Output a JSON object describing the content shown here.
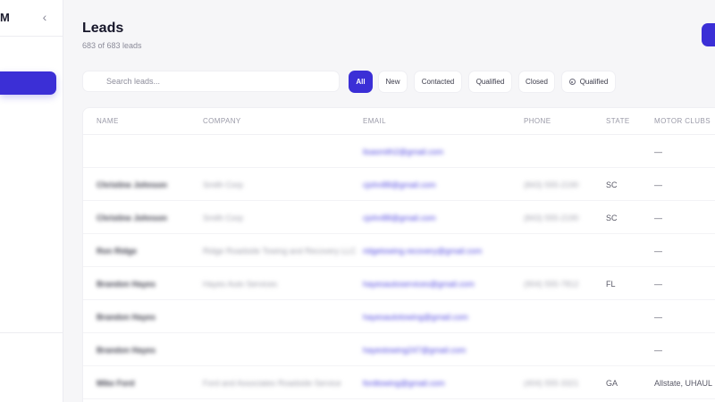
{
  "sidebar": {
    "brand": "M",
    "collapse_icon": "chevron-left-icon"
  },
  "header": {
    "title": "Leads",
    "subtitle": "683 of 683 leads"
  },
  "search": {
    "placeholder": "Search leads...",
    "icon": "search-icon"
  },
  "filters": [
    {
      "label": "All",
      "active": true
    },
    {
      "label": "New"
    },
    {
      "label": "Contacted"
    },
    {
      "label": "Qualified"
    },
    {
      "label": "Closed"
    },
    {
      "label": "Qualified",
      "icon": "target-icon"
    }
  ],
  "table": {
    "columns": [
      "NAME",
      "COMPANY",
      "EMAIL",
      "PHONE",
      "STATE",
      "MOTOR CLUBS"
    ],
    "rows": [
      {
        "name": "",
        "company": "",
        "email": "lisasmith2@gmail.com",
        "phone": "",
        "state": "",
        "clubs": "—"
      },
      {
        "name": "Christine Johnson",
        "company": "Smith Corp",
        "email": "cjohn88@gmail.com",
        "phone": "(843) 555-2190",
        "state": "SC",
        "clubs": "—"
      },
      {
        "name": "Christine Johnson",
        "company": "Smith Corp",
        "email": "cjohn88@gmail.com",
        "phone": "(843) 555-2190",
        "state": "SC",
        "clubs": "—"
      },
      {
        "name": "Ron Ridge",
        "company": "Ridge Roadside Towing and Recovery LLC",
        "email": "ridgetowing.recovery@gmail.com",
        "phone": "",
        "state": "",
        "clubs": "—"
      },
      {
        "name": "Brandon Hayes",
        "company": "Hayes Auto Services",
        "email": "hayesautoservices@gmail.com",
        "phone": "(904) 555-7812",
        "state": "FL",
        "clubs": "—"
      },
      {
        "name": "Brandon Hayes",
        "company": "",
        "email": "hayesautotowing@gmail.com",
        "phone": "",
        "state": "",
        "clubs": "—"
      },
      {
        "name": "Brandon Hayes",
        "company": "",
        "email": "hayestowing247@gmail.com",
        "phone": "",
        "state": "",
        "clubs": "—"
      },
      {
        "name": "Mike Ford",
        "company": "Ford and Associates Roadside Service",
        "email": "fordtowing@gmail.com",
        "phone": "(404) 555-3321",
        "state": "GA",
        "clubs": "Allstate, UHAUL"
      }
    ]
  },
  "colors": {
    "accent": "#3b2fd6",
    "background": "#f6f6f8",
    "email": "#4f45e0"
  }
}
